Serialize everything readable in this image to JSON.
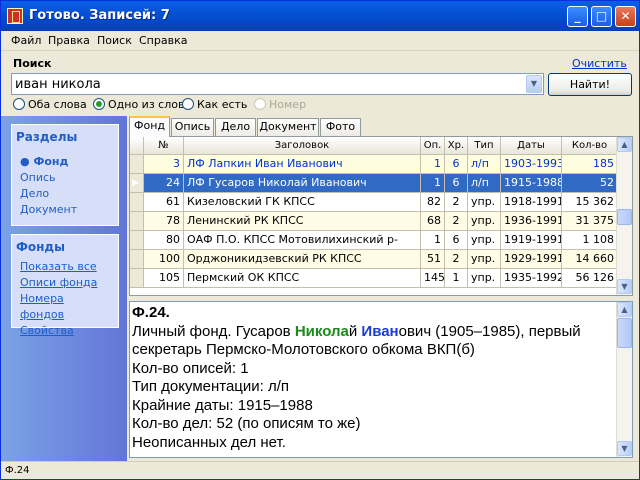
{
  "window": {
    "title": "Готово. Записей: 7",
    "buttons": {
      "minimize": "_",
      "maximize": "□",
      "close": "✕"
    }
  },
  "menu": [
    "Файл",
    "Правка",
    "Поиск",
    "Справка"
  ],
  "search": {
    "label": "Поиск",
    "clear_link": "Очистить",
    "value": "иван никола",
    "find_button": "Найти!",
    "options": [
      {
        "label": "Оба слова",
        "selected": false,
        "enabled": true
      },
      {
        "label": "Одно из слов",
        "selected": true,
        "enabled": true
      },
      {
        "label": "Как есть",
        "selected": false,
        "enabled": true
      },
      {
        "label": "Номер",
        "selected": false,
        "enabled": false
      }
    ]
  },
  "sidebar": {
    "sections_title": "Разделы",
    "sections": [
      {
        "label": "Фонд",
        "active": true
      },
      {
        "label": "Опись",
        "active": false
      },
      {
        "label": "Дело",
        "active": false
      },
      {
        "label": "Документ",
        "active": false
      }
    ],
    "funds_title": "Фонды",
    "funds_links": [
      "Показать все",
      "Описи фонда",
      "Номера фондов",
      "Свойства"
    ]
  },
  "tabs": [
    "Фонд",
    "Опись",
    "Дело",
    "Документ",
    "Фото"
  ],
  "active_tab": "Фонд",
  "table": {
    "columns": [
      "№",
      "Заголовок",
      "Оп.",
      "Хр.",
      "Тип",
      "Даты",
      "Кол-во"
    ],
    "rows": [
      {
        "num": "3",
        "title": "ЛФ Лапкин Иван Иванович",
        "op": "1",
        "hr": "6",
        "type": "л/п",
        "dates": "1903-1993",
        "count": "185",
        "state": "highlight"
      },
      {
        "num": "24",
        "title": "ЛФ Гусаров Николай Иванович",
        "op": "1",
        "hr": "6",
        "type": "л/п",
        "dates": "1915-1988",
        "count": "52",
        "state": "selected"
      },
      {
        "num": "61",
        "title": "Кизеловский ГК КПСС",
        "op": "82",
        "hr": "2",
        "type": "упр.",
        "dates": "1918-1991",
        "count": "15 362",
        "state": "plain"
      },
      {
        "num": "78",
        "title": "Ленинский РК КПСС",
        "op": "68",
        "hr": "2",
        "type": "упр.",
        "dates": "1936-1991",
        "count": "31 375",
        "state": "yellow"
      },
      {
        "num": "80",
        "title": "ОАФ П.О. КПСС Мотовилихинский р-",
        "op": "1",
        "hr": "6",
        "type": "упр.",
        "dates": "1919-1991",
        "count": "1 108",
        "state": "plain"
      },
      {
        "num": "100",
        "title": "Орджоникидзевский РК КПСС",
        "op": "51",
        "hr": "2",
        "type": "упр.",
        "dates": "1929-1991",
        "count": "14 660",
        "state": "yellow"
      },
      {
        "num": "105",
        "title": "Пермский ОК КПСС",
        "op": "145",
        "hr": "1",
        "type": "упр.",
        "dates": "1935-1992",
        "count": "56 126",
        "state": "plain"
      }
    ]
  },
  "detail": {
    "heading": "Ф.24.",
    "line1_pre": "Личный фонд. Гусаров ",
    "line1_hl1": "Никола",
    "line1_mid1": "й ",
    "line1_hl2": "Иван",
    "line1_post": "ович (1905–1985), первый секретарь Пермско-Молотовского обкома ВКП(б)",
    "lines": [
      "Кол-во описей: 1",
      "Тип документации: л/п",
      "Крайние даты: 1915–1988",
      "Кол-во дел: 52 (по описям то же)",
      "Неописанных дел нет."
    ]
  },
  "status": "Ф.24",
  "colors": {
    "title_bar": "#0552d4",
    "selection": "#316ac5",
    "highlight_green": "#1a8a1a",
    "highlight_blue": "#1a3cd8",
    "link": "#0033cc"
  }
}
